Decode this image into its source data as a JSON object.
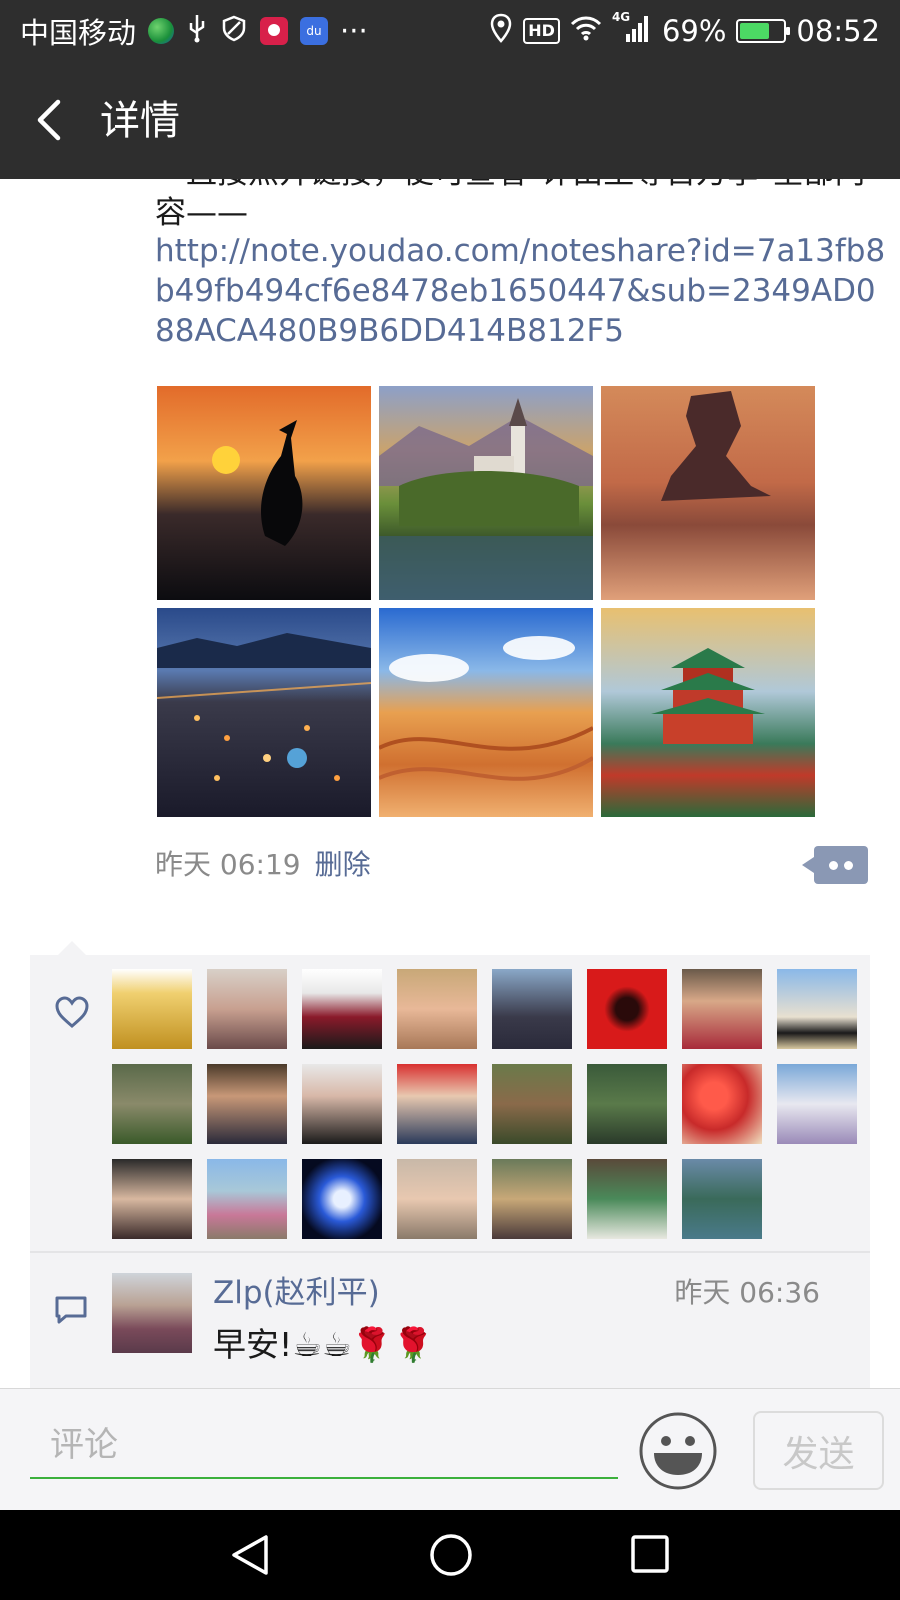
{
  "status_bar": {
    "carrier": "中国移动",
    "more_indicator": "···",
    "hd": "HD",
    "network": "4G",
    "battery": "69%",
    "battery_level": 0.69,
    "time": "08:52",
    "icons": [
      "globe-icon",
      "usb-icon",
      "shield-icon",
      "video-app-icon",
      "baidu-app-icon",
      "location-icon",
      "wifi-icon",
      "signal-icon",
      "battery-icon"
    ]
  },
  "header": {
    "title": "详情",
    "back_icon": "chevron-left-icon"
  },
  "post": {
    "text_partial": "一直接点开链接，便可查看\"评由至尊百万享\"全部内容——",
    "link": "http://note.youdao.com/noteshare?id=7a13fb8b49fb494cf6e8478eb1650447&sub=2349AD088ACA480B9B6DD414B812F5",
    "time": "昨天 06:19",
    "delete_label": "删除"
  },
  "likes": {
    "icon": "heart-icon",
    "count": 23
  },
  "comments": [
    {
      "name": "Zlp(赵利平)",
      "time": "昨天 06:36",
      "text": "早安!☕☕🌹🌹"
    }
  ],
  "input_bar": {
    "placeholder": "评论",
    "send_label": "发送",
    "emoji_icon": "smiley-icon"
  },
  "nav_bar": {
    "icons": [
      "back-triangle-icon",
      "home-circle-icon",
      "recent-square-icon"
    ]
  },
  "colors": {
    "bar_dark": "#2e2e2e",
    "link_blue": "#576b95",
    "input_underline": "#3cb03c"
  }
}
